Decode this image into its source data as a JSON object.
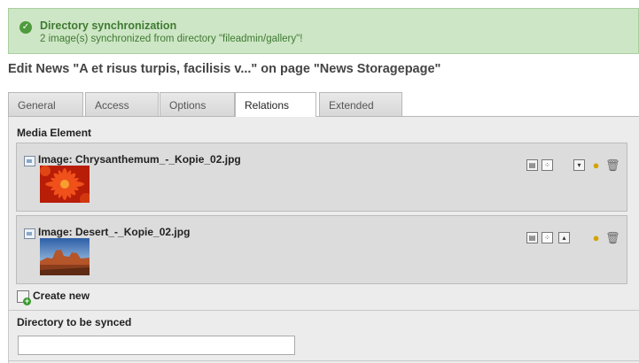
{
  "flash": {
    "title": "Directory synchronization",
    "message": "2 image(s) synchronized from directory \"fileadmin/gallery\"!"
  },
  "page_title": "Edit News \"A et risus turpis, facilisis v...\" on page \"News Storagepage\"",
  "tabs": [
    {
      "label": "General"
    },
    {
      "label": "Access"
    },
    {
      "label": "Options"
    },
    {
      "label": "Relations",
      "active": true
    },
    {
      "label": "Extended"
    }
  ],
  "media_element": {
    "label": "Media Element",
    "items": [
      {
        "title": "Image: Chrysanthemum_-_Kopie_02.jpg",
        "thumb": "flower"
      },
      {
        "title": "Image: Desert_-_Kopie_02.jpg",
        "thumb": "desert"
      }
    ],
    "create_new_label": "Create new"
  },
  "directory": {
    "label": "Directory to be synced",
    "value": ""
  },
  "colors": {
    "flash_bg": "#cde6c5",
    "flash_text": "#3f7a32",
    "panel_bg": "#ececec",
    "record_bg": "#dcdcdc"
  }
}
